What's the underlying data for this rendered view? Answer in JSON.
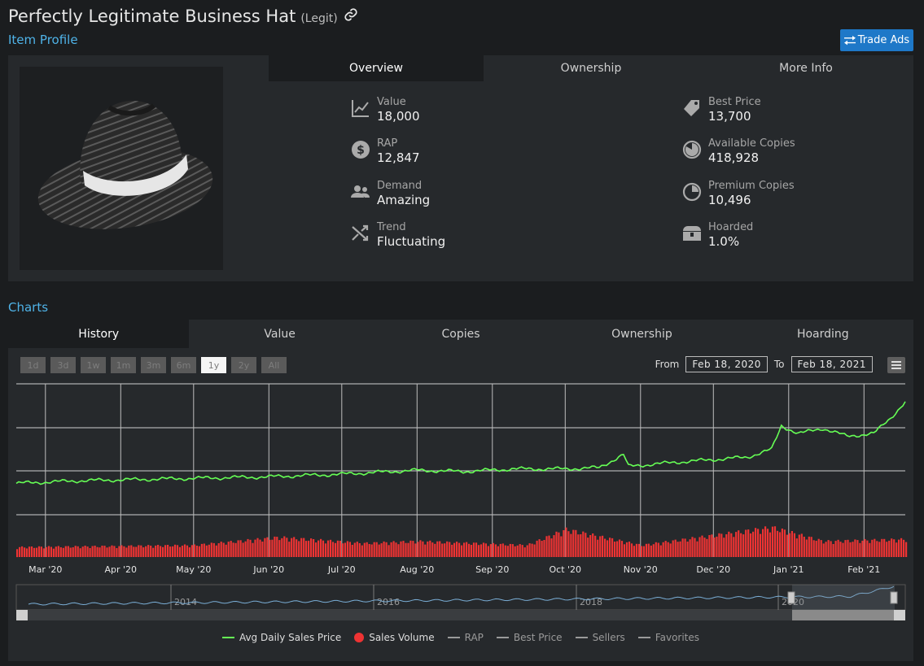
{
  "header": {
    "title": "Perfectly Legitimate Business Hat",
    "tag": "(Legit)",
    "subtitle": "Item Profile",
    "trade_ads_label": "Trade Ads"
  },
  "profile_tabs": [
    {
      "label": "Overview",
      "active": true
    },
    {
      "label": "Ownership",
      "active": false
    },
    {
      "label": "More Info",
      "active": false
    }
  ],
  "stats_left": [
    {
      "label": "Value",
      "value": "18,000",
      "icon": "chart-line-icon"
    },
    {
      "label": "RAP",
      "value": "12,847",
      "icon": "dollar-circle-icon"
    },
    {
      "label": "Demand",
      "value": "Amazing",
      "icon": "people-icon"
    },
    {
      "label": "Trend",
      "value": "Fluctuating",
      "icon": "shuffle-icon"
    }
  ],
  "stats_right": [
    {
      "label": "Best Price",
      "value": "13,700",
      "icon": "price-tag-icon"
    },
    {
      "label": "Available Copies",
      "value": "418,928",
      "icon": "pie-icon"
    },
    {
      "label": "Premium Copies",
      "value": "10,496",
      "icon": "pie-outline-icon"
    },
    {
      "label": "Hoarded",
      "value": "1.0%",
      "icon": "treasure-chest-icon"
    }
  ],
  "charts_label": "Charts",
  "chart_tabs": [
    {
      "label": "History",
      "active": true
    },
    {
      "label": "Value",
      "active": false
    },
    {
      "label": "Copies",
      "active": false
    },
    {
      "label": "Ownership",
      "active": false
    },
    {
      "label": "Hoarding",
      "active": false
    }
  ],
  "range_buttons": [
    {
      "label": "1d",
      "active": false
    },
    {
      "label": "3d",
      "active": false
    },
    {
      "label": "1w",
      "active": false
    },
    {
      "label": "1m",
      "active": false
    },
    {
      "label": "3m",
      "active": false
    },
    {
      "label": "6m",
      "active": false
    },
    {
      "label": "1y",
      "active": true
    },
    {
      "label": "2y",
      "active": false
    },
    {
      "label": "All",
      "active": false
    }
  ],
  "date_range": {
    "from_label": "From",
    "from": "Feb 18, 2020",
    "to_label": "To",
    "to": "Feb 18, 2021"
  },
  "colors": {
    "price_line": "#66ff55",
    "volume_bar": "#ee3333",
    "navigator_line": "#7aaed6",
    "accent": "#4fb3e8"
  },
  "chart_data": {
    "type": "line",
    "x_range": [
      "2020-02-18",
      "2021-02-18"
    ],
    "x_tick_labels": [
      "Mar '20",
      "Apr '20",
      "May '20",
      "Jun '20",
      "Jul '20",
      "Aug '20",
      "Sep '20",
      "Oct '20",
      "Nov '20",
      "Dec '20",
      "Jan '21",
      "Feb '21"
    ],
    "series": [
      {
        "name": "Avg Daily Sales Price",
        "color": "#66ff55",
        "values": [
          [
            "2020-02-18",
            22
          ],
          [
            "2020-03-15",
            23
          ],
          [
            "2020-04-10",
            23.5
          ],
          [
            "2020-05-05",
            24
          ],
          [
            "2020-06-01",
            24.5
          ],
          [
            "2020-07-01",
            25.5
          ],
          [
            "2020-08-01",
            27
          ],
          [
            "2020-08-20",
            26.5
          ],
          [
            "2020-09-10",
            27.5
          ],
          [
            "2020-10-01",
            27.5
          ],
          [
            "2020-10-15",
            28
          ],
          [
            "2020-10-25",
            33
          ],
          [
            "2020-10-27",
            28.5
          ],
          [
            "2020-11-15",
            30
          ],
          [
            "2020-12-15",
            32
          ],
          [
            "2020-12-25",
            35
          ],
          [
            "2020-12-29",
            44
          ],
          [
            "2021-01-05",
            41
          ],
          [
            "2021-01-15",
            43
          ],
          [
            "2021-01-25",
            40
          ],
          [
            "2021-02-05",
            41
          ],
          [
            "2021-02-12",
            47
          ],
          [
            "2021-02-18",
            53
          ]
        ]
      },
      {
        "name": "Sales Volume",
        "color": "#ee3333",
        "values": [
          [
            "2020-02-18",
            25
          ],
          [
            "2020-05-01",
            30
          ],
          [
            "2020-06-05",
            50
          ],
          [
            "2020-07-10",
            35
          ],
          [
            "2020-08-01",
            40
          ],
          [
            "2020-09-15",
            30
          ],
          [
            "2020-10-01",
            70
          ],
          [
            "2020-11-01",
            30
          ],
          [
            "2020-12-25",
            75
          ],
          [
            "2021-01-15",
            40
          ],
          [
            "2021-02-18",
            45
          ]
        ]
      }
    ],
    "navigator": {
      "tick_labels": [
        "2014",
        "2016",
        "2018",
        "2020"
      ]
    },
    "legend": [
      "Avg Daily Sales Price",
      "Sales Volume",
      "RAP",
      "Best Price",
      "Sellers",
      "Favorites"
    ],
    "legend_colors": [
      "#66ff55",
      "#ee3333",
      "#9a9a9a",
      "#9a9a9a",
      "#9a9a9a",
      "#9a9a9a"
    ],
    "grid": true
  }
}
